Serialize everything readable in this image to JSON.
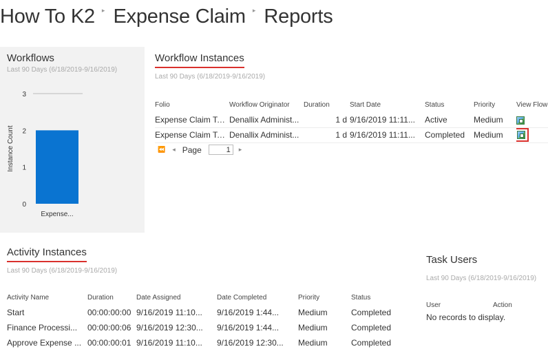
{
  "breadcrumb": {
    "items": [
      "How To K2",
      "Expense Claim",
      "Reports"
    ],
    "separator": "▸"
  },
  "workflows_panel": {
    "title": "Workflows",
    "subtitle": "Last 90 Days (6/18/2019-9/16/2019)"
  },
  "chart_data": {
    "type": "bar",
    "categories": [
      "Expense..."
    ],
    "values": [
      2
    ],
    "ylabel": "Instance Count",
    "xlabel": "",
    "ylim": [
      0,
      3
    ],
    "yticks": [
      0,
      1,
      2,
      3
    ],
    "bar_color": "#0a74d1",
    "grid": false
  },
  "workflow_instances": {
    "title": "Workflow Instances",
    "subtitle": "Last 90 Days (6/18/2019-9/16/2019)",
    "columns": [
      "Folio",
      "Workflow Originator",
      "Duration",
      "Start Date",
      "Status",
      "Priority",
      "View Flow"
    ],
    "rows": [
      {
        "folio": "Expense Claim Test",
        "originator": "Denallix Administ...",
        "duration": "1 d",
        "start_date": "9/16/2019 11:11...",
        "status": "Active",
        "priority": "Medium",
        "view_flow_icon": "view-flow-icon"
      },
      {
        "folio": "Expense Claim Test",
        "originator": "Denallix Administ...",
        "duration": "1 d",
        "start_date": "9/16/2019 11:11...",
        "status": "Completed",
        "priority": "Medium",
        "view_flow_icon": "view-flow-icon"
      }
    ],
    "pager": {
      "first_icon": "⏪",
      "prev_icon": "◂",
      "label": "Page",
      "value": "1",
      "next_icon": "▸"
    }
  },
  "activity_instances": {
    "title": "Activity Instances",
    "subtitle": "Last 90 Days (6/18/2019-9/16/2019)",
    "columns": [
      "Activity Name",
      "Duration",
      "Date Assigned",
      "Date Completed",
      "Priority",
      "Status"
    ],
    "rows": [
      {
        "name": "Start",
        "duration": "00:00:00:00",
        "assigned": "9/16/2019 11:10...",
        "completed": "9/16/2019 1:44...",
        "priority": "Medium",
        "status": "Completed"
      },
      {
        "name": "Finance Processi...",
        "duration": "00:00:00:06",
        "assigned": "9/16/2019 12:30...",
        "completed": "9/16/2019 1:44...",
        "priority": "Medium",
        "status": "Completed"
      },
      {
        "name": "Approve Expense ...",
        "duration": "00:00:00:01",
        "assigned": "9/16/2019 11:10...",
        "completed": "9/16/2019 12:30...",
        "priority": "Medium",
        "status": "Completed"
      }
    ]
  },
  "task_users": {
    "title": "Task Users",
    "subtitle": "Last 90 Days (6/18/2019-9/16/2019)",
    "columns": [
      "User",
      "Action"
    ],
    "empty_text": "No records to display."
  },
  "colors": {
    "accent_underline": "#d9302c",
    "panel_bg": "#f2f2f2",
    "bar": "#0a74d1"
  }
}
